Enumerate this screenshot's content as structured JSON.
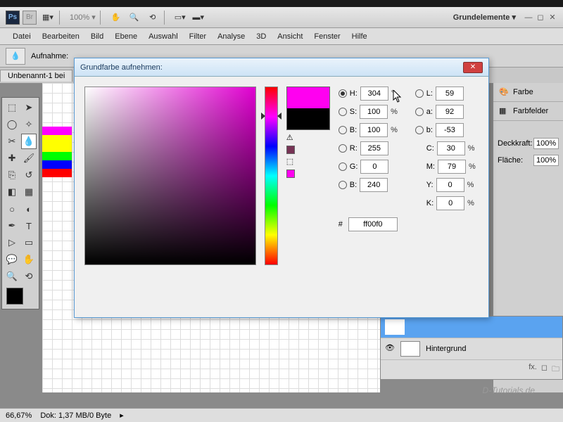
{
  "app": {
    "zoom_display": "100% ▾",
    "workspace_label": "Grundelemente ▾"
  },
  "menu": {
    "file": "Datei",
    "edit": "Bearbeiten",
    "image": "Bild",
    "layer": "Ebene",
    "select": "Auswahl",
    "filter": "Filter",
    "analyze": "Analyse",
    "three_d": "3D",
    "view": "Ansicht",
    "window": "Fenster",
    "help": "Hilfe"
  },
  "optbar": {
    "sample_label": "Aufnahme:"
  },
  "doc": {
    "tab_title": "Unbenannt-1 bei"
  },
  "panels": {
    "color": "Farbe",
    "swatches": "Farbfelder",
    "opacity_label": "Deckkraft:",
    "opacity_value": "100%",
    "fill_label": "Fläche:",
    "fill_value": "100%"
  },
  "layers": {
    "bg_name": "Hintergrund"
  },
  "status": {
    "zoom": "66,67%",
    "doc_info": "Dok: 1,37 MB/0 Byte"
  },
  "watermark": "D-Tutorials.de",
  "stripe_colors": [
    "#ff00ff",
    "#ffff00",
    "#ffff00",
    "#00ff00",
    "#0000ff",
    "#ff0000"
  ],
  "picker": {
    "title": "Grundfarbe aufnehmen:",
    "new_color": "#ff00f0",
    "old_color": "#000000",
    "tiny1": "#773355",
    "tiny2": "#ff00f0",
    "H_label": "H:",
    "H_val": "304",
    "H_unit": "°",
    "S_label": "S:",
    "S_val": "100",
    "S_unit": "%",
    "B_label": "B:",
    "B_val": "100",
    "B_unit": "%",
    "R_label": "R:",
    "R_val": "255",
    "G_label": "G:",
    "G_val": "0",
    "Bl_label": "B:",
    "Bl_val": "240",
    "L_label": "L:",
    "L_val": "59",
    "a_label": "a:",
    "a_val": "92",
    "b_label": "b:",
    "b_val": "-53",
    "C_label": "C:",
    "C_val": "30",
    "C_unit": "%",
    "M_label": "M:",
    "M_val": "79",
    "M_unit": "%",
    "Y_label": "Y:",
    "Y_val": "0",
    "Y_unit": "%",
    "K_label": "K:",
    "K_val": "0",
    "K_unit": "%",
    "hex_label": "#",
    "hex_val": "ff00f0"
  }
}
